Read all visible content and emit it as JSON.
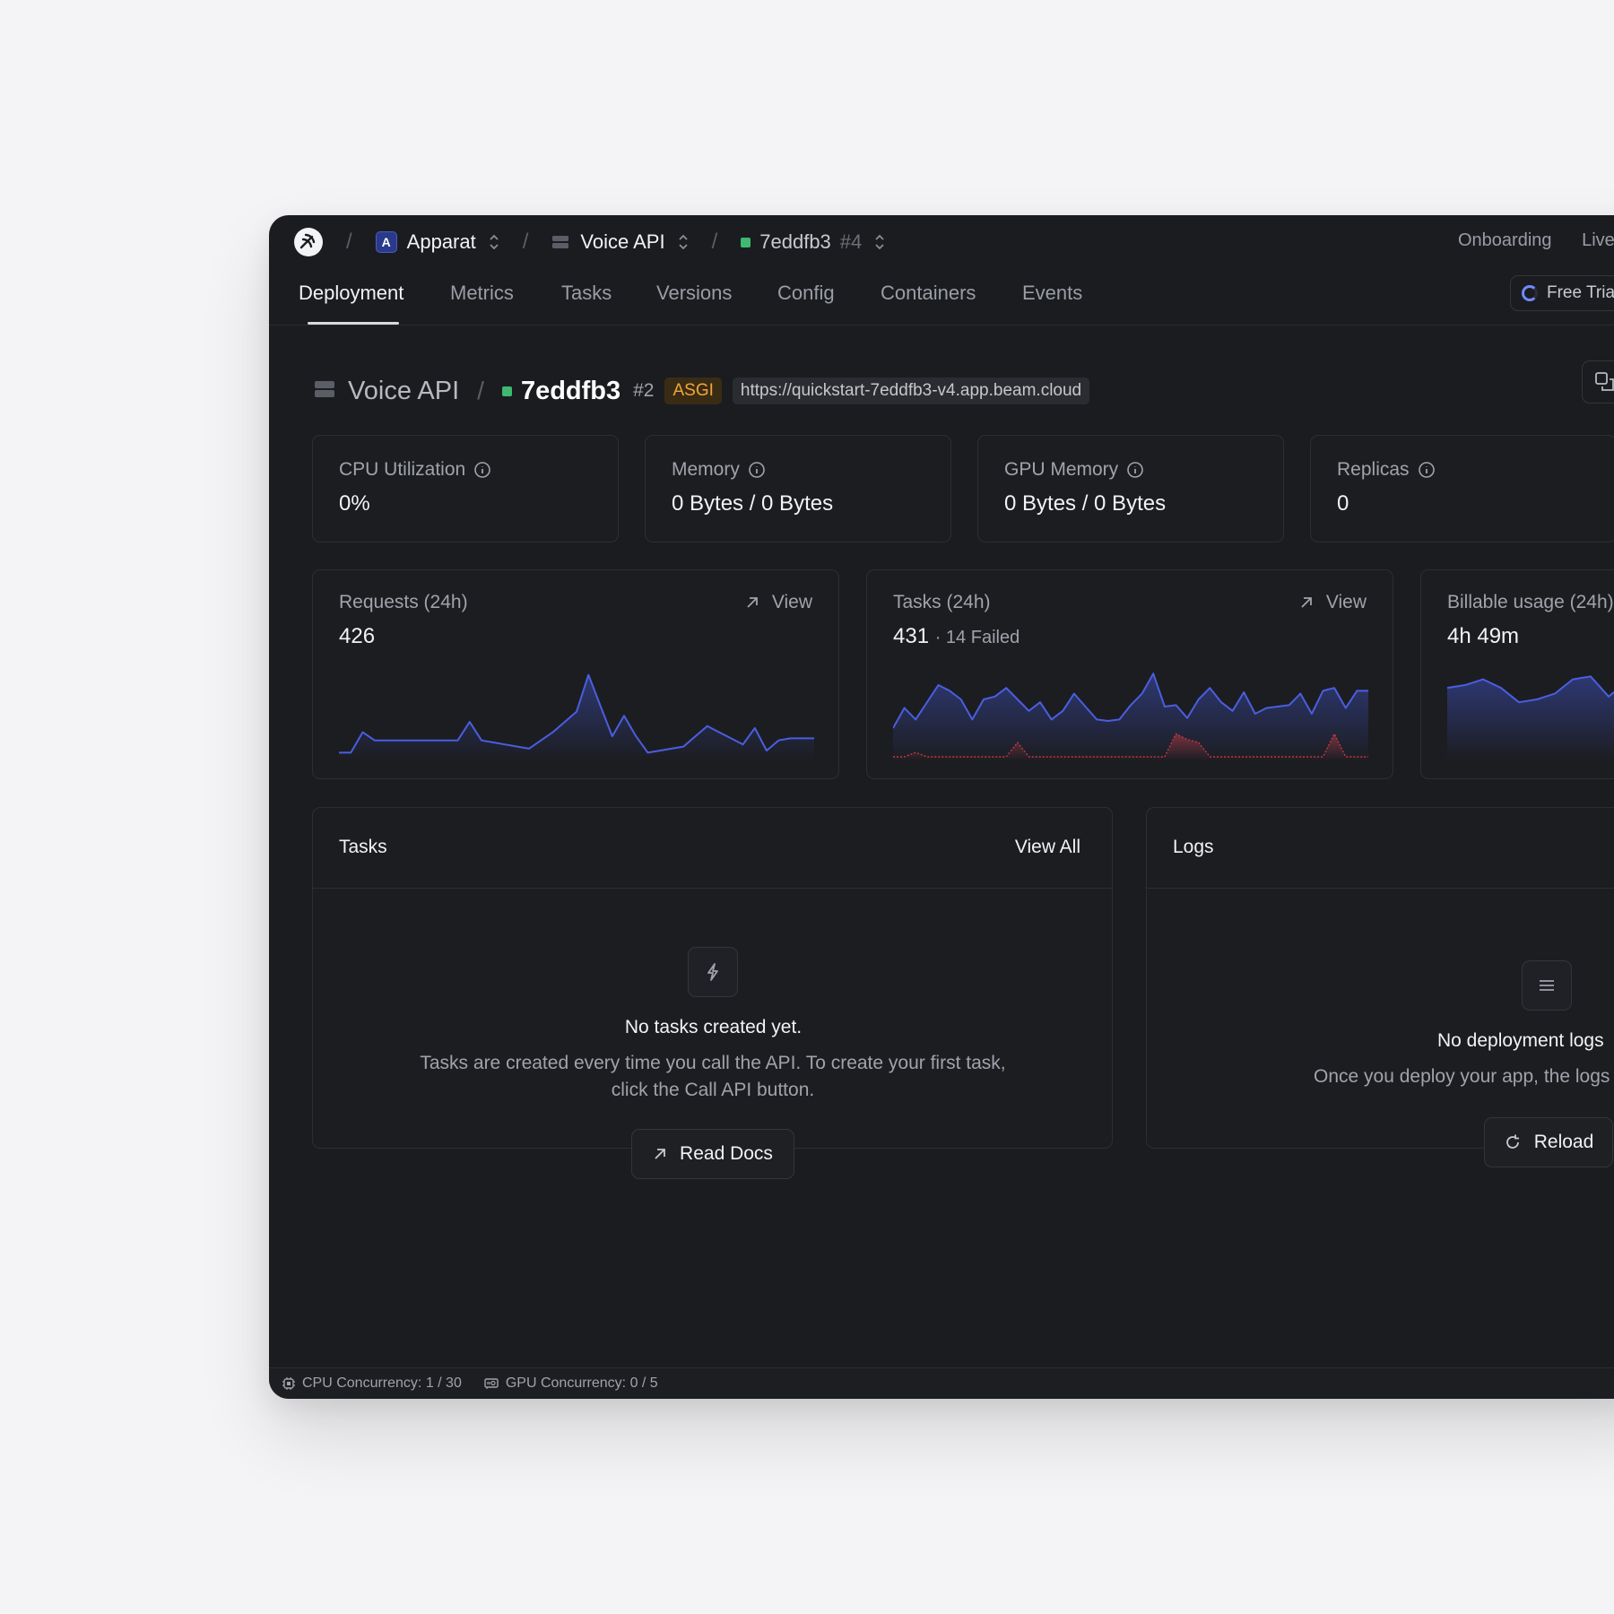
{
  "breadcrumb": {
    "org_initial": "A",
    "org": "Apparat",
    "app": "Voice API",
    "deployment": "7eddfb3",
    "deployment_version": "#4"
  },
  "top_links": [
    "Onboarding",
    "Live"
  ],
  "tabs": [
    "Deployment",
    "Metrics",
    "Tasks",
    "Versions",
    "Config",
    "Containers",
    "Events"
  ],
  "trial_label": "Free Trial",
  "header": {
    "app": "Voice API",
    "deployment": "7eddfb3",
    "version": "#2",
    "badge": "ASGI",
    "url": "https://quickstart-7eddfb3-v4.app.beam.cloud"
  },
  "stats": [
    {
      "label": "CPU Utilization",
      "value": "0%"
    },
    {
      "label": "Memory",
      "value": "0 Bytes / 0 Bytes"
    },
    {
      "label": "GPU Memory",
      "value": "0 Bytes / 0 Bytes"
    },
    {
      "label": "Replicas",
      "value": "0"
    }
  ],
  "metrics": {
    "requests": {
      "label": "Requests (24h)",
      "value": "426",
      "view": "View"
    },
    "tasks": {
      "label": "Tasks (24h)",
      "value": "431",
      "failed": "· 14 Failed",
      "view": "View"
    },
    "billable": {
      "label": "Billable usage (24h)",
      "value": "4h 49m"
    }
  },
  "tasks_panel": {
    "title": "Tasks",
    "action": "View All",
    "empty_title": "No tasks created yet.",
    "empty_body": "Tasks are created every time you call the API. To create your first task, click the Call API button.",
    "button": "Read Docs"
  },
  "logs_panel": {
    "title": "Logs",
    "empty_title": "No deployment logs",
    "empty_body": "Once you deploy your app, the logs",
    "button": "Reload"
  },
  "footer": {
    "cpu": "CPU Concurrency: 1 / 30",
    "gpu": "GPU Concurrency: 0 / 5"
  },
  "chart_data": [
    {
      "type": "area",
      "title": "Requests (24h)",
      "values": [
        2,
        2,
        12,
        8,
        8,
        8,
        8,
        8,
        8,
        8,
        8,
        17,
        8,
        7,
        6,
        5,
        4,
        8,
        12,
        17,
        22,
        40,
        25,
        10,
        20,
        10,
        2,
        3,
        4,
        5,
        10,
        15,
        12,
        9,
        6,
        14,
        3,
        8,
        9,
        9,
        9
      ]
    },
    {
      "type": "area",
      "title": "Tasks (24h)",
      "series": [
        {
          "name": "",
          "values": [
            20,
            34,
            26,
            38,
            50,
            46,
            40,
            26,
            40,
            42,
            48,
            40,
            32,
            38,
            26,
            32,
            44,
            35,
            26,
            25,
            26,
            36,
            44,
            58,
            35,
            36,
            27,
            40,
            48,
            38,
            32,
            45,
            30,
            34,
            35,
            36,
            44,
            30,
            46,
            48,
            34,
            46,
            46
          ]
        },
        {
          "name": "",
          "values": [
            0,
            0,
            3,
            0,
            0,
            0,
            0,
            0,
            0,
            0,
            0,
            10,
            0,
            0,
            0,
            0,
            0,
            0,
            0,
            0,
            0,
            0,
            0,
            0,
            0,
            16,
            12,
            10,
            0,
            0,
            0,
            0,
            0,
            0,
            0,
            0,
            0,
            0,
            0,
            16,
            0,
            0,
            0
          ]
        }
      ]
    },
    {
      "type": "area",
      "title": "Billable usage (24h)",
      "values": [
        48,
        50,
        54,
        48,
        38,
        40,
        44,
        54,
        56,
        42,
        52,
        50,
        46,
        44
      ]
    }
  ]
}
